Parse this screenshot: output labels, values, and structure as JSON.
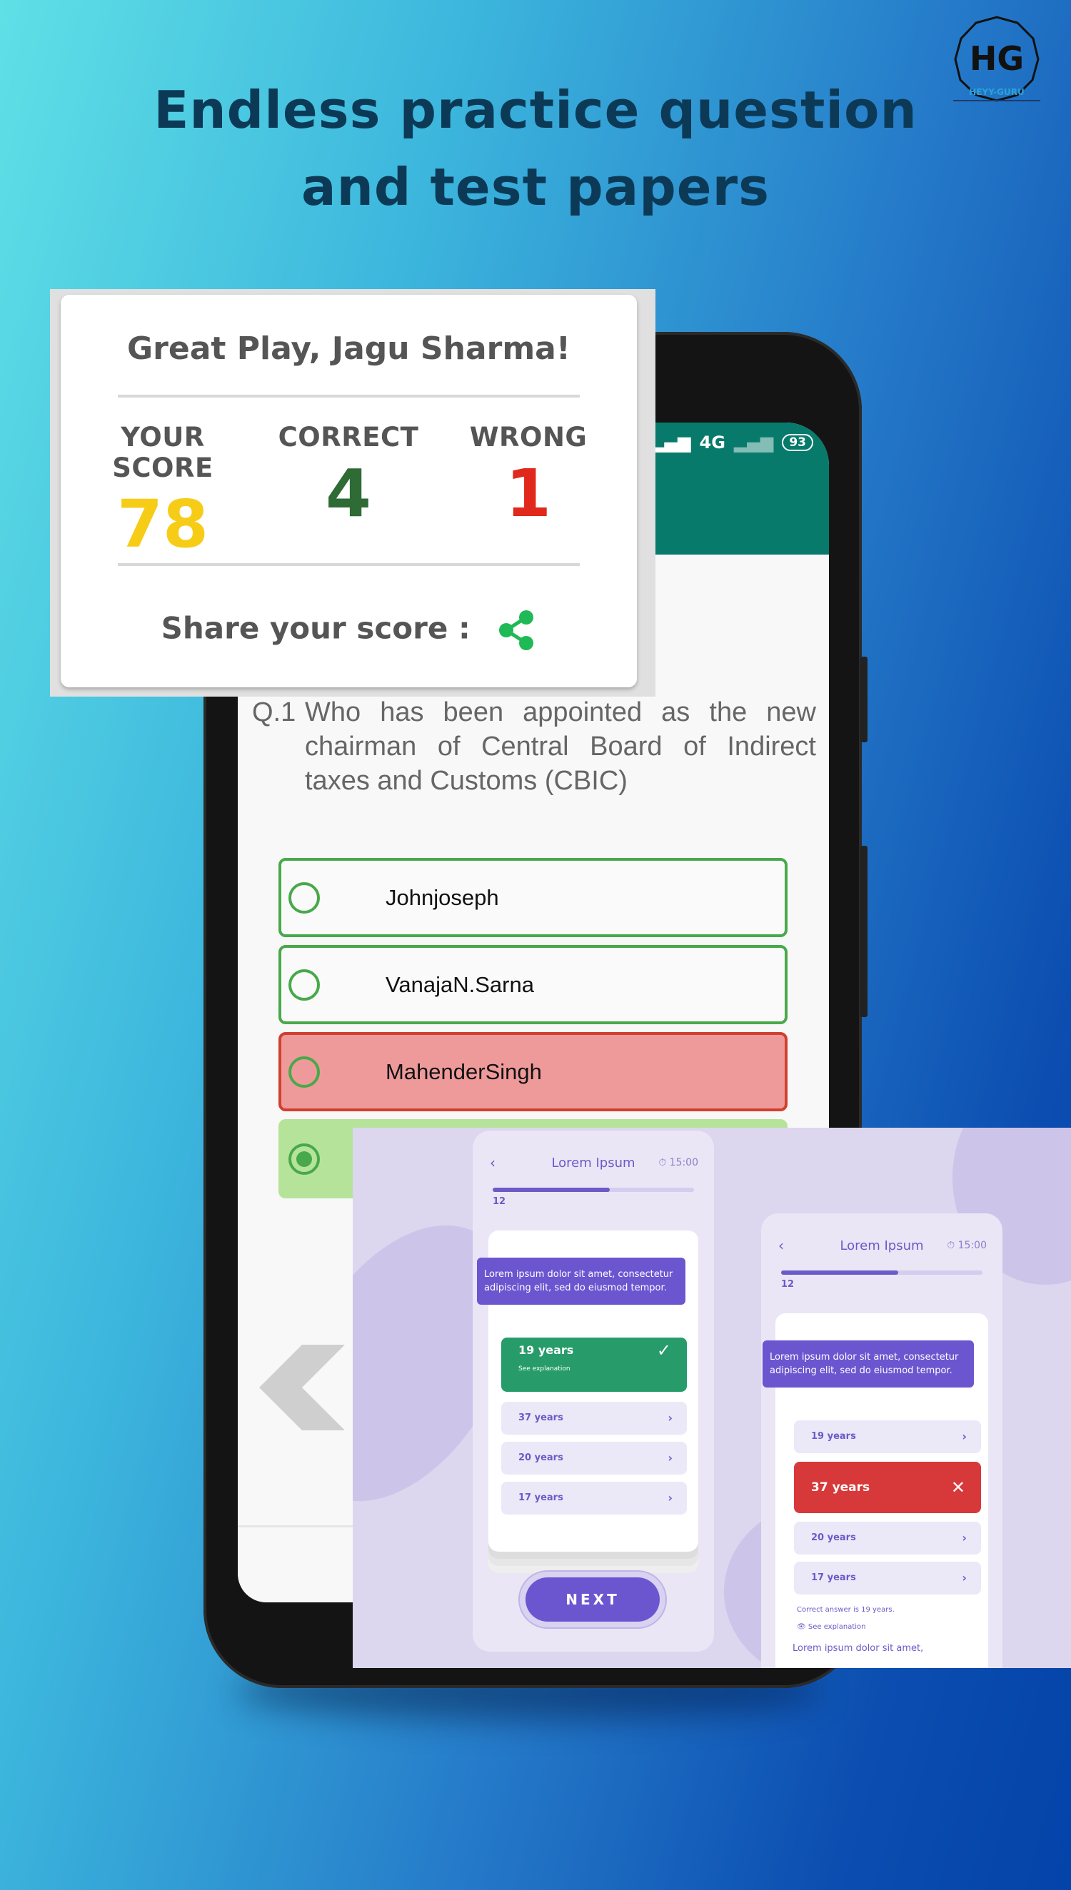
{
  "headline": {
    "line1": "Endless practice question",
    "line2": "and test papers"
  },
  "logo": {
    "initials": "HG",
    "text": "HEYY-GURU"
  },
  "status_bar": {
    "network": "4G",
    "battery": "93"
  },
  "score_card": {
    "title": "Great Play, Jagu Sharma!",
    "your_score_label": "YOUR SCORE",
    "your_score_value": "78",
    "correct_label": "CORRECT",
    "correct_value": "4",
    "wrong_label": "WRONG",
    "wrong_value": "1",
    "share_label": "Share your score :",
    "colors": {
      "score": "#f6cc17",
      "correct": "#2e6b35",
      "wrong": "#e0291c",
      "share_icon": "#1fb955"
    }
  },
  "question": {
    "number": "Q.1",
    "text": "Who has been appointed as the new chairman of Central Board of Indirect taxes and Customs (CBIC)"
  },
  "options": [
    {
      "label": "Johnjoseph",
      "state": "default"
    },
    {
      "label": "VanajaN.Sarna",
      "state": "default"
    },
    {
      "label": "MahenderSingh",
      "state": "wrong"
    },
    {
      "label": "",
      "state": "correct"
    }
  ],
  "collage": {
    "left_screen": {
      "title": "Lorem Ipsum",
      "time": "15:00",
      "count": "12",
      "question": "Lorem ipsum dolor sit amet, consectetur adipiscing elit, sed do eiusmod tempor.",
      "options": [
        {
          "label": "19 years",
          "state": "correct",
          "sub": "See explanation"
        },
        {
          "label": "37 years",
          "state": "default"
        },
        {
          "label": "20 years",
          "state": "default"
        },
        {
          "label": "17 years",
          "state": "default"
        }
      ],
      "next_label": "NEXT"
    },
    "right_screen": {
      "title": "Lorem Ipsum",
      "time": "15:00",
      "count": "12",
      "question": "Lorem ipsum dolor sit amet, consectetur adipiscing elit, sed do eiusmod tempor.",
      "options": [
        {
          "label": "19 years",
          "state": "default"
        },
        {
          "label": "37 years",
          "state": "wrong"
        },
        {
          "label": "20 years",
          "state": "default"
        },
        {
          "label": "17 years",
          "state": "default"
        }
      ],
      "correct_note": "Correct answer is 19 years.",
      "see_explanation": "See explanation",
      "footer_text": "Lorem ipsum dolor sit amet,"
    }
  }
}
